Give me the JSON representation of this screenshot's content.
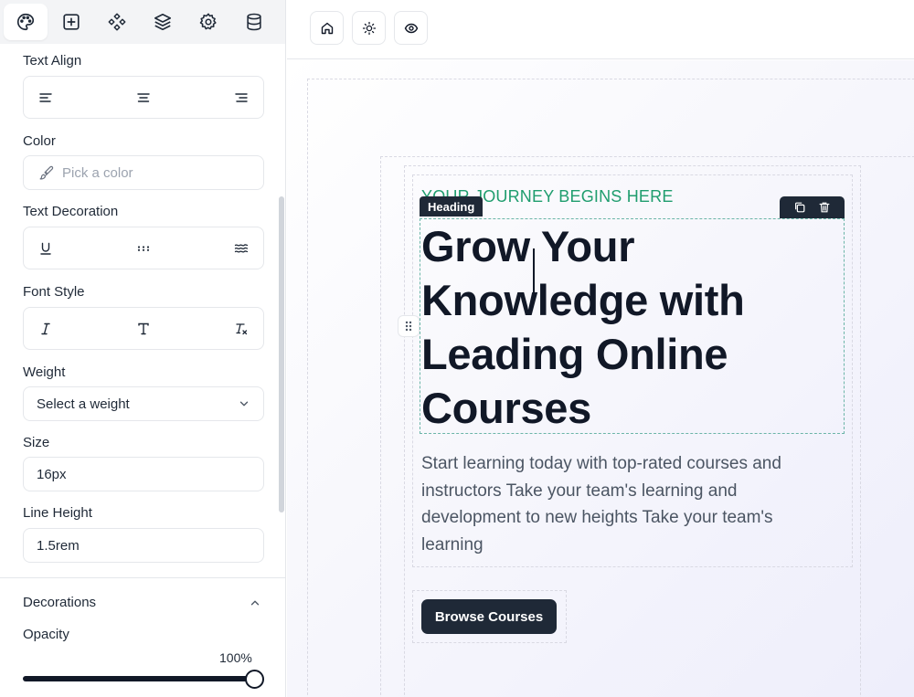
{
  "sidebar": {
    "nav": [
      {
        "icon": "palette-icon",
        "active": true
      },
      {
        "icon": "add-block-icon",
        "active": false
      },
      {
        "icon": "components-icon",
        "active": false
      },
      {
        "icon": "layers-icon",
        "active": false
      },
      {
        "icon": "settings-gear-icon",
        "active": false
      },
      {
        "icon": "database-icon",
        "active": false
      }
    ],
    "text_align_label": "Text Align",
    "color_label": "Color",
    "color_placeholder": "Pick a color",
    "text_decoration_label": "Text Decoration",
    "font_style_label": "Font Style",
    "weight_label": "Weight",
    "weight_placeholder": "Select a weight",
    "size_label": "Size",
    "size_value": "16px",
    "line_height_label": "Line Height",
    "line_height_value": "1.5rem",
    "decorations_label": "Decorations",
    "opacity_label": "Opacity",
    "opacity_value": "100%",
    "opacity_fraction": 1.0
  },
  "toolbar": {
    "buttons": [
      "home-icon",
      "sun-icon",
      "eye-icon"
    ]
  },
  "canvas": {
    "eyebrow": "YOUR JOURNEY BEGINS HERE",
    "heading_tag": "Heading",
    "heading": "Grow Your Knowledge with Leading Online Courses",
    "paragraph": "Start learning today with top-rated courses and instructors Take your team's learning and development to new heights Take your team's learning",
    "cta_label": "Browse Courses"
  },
  "colors": {
    "accent_green": "#1f9d6e",
    "dark": "#1f2937",
    "selection_outline": "#6bb5a8"
  }
}
